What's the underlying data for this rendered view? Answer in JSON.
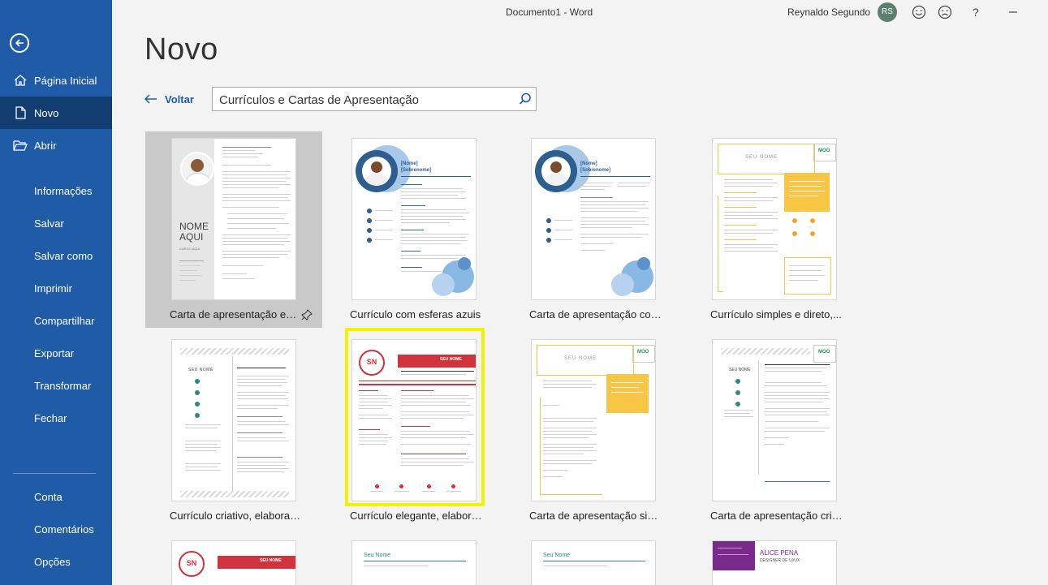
{
  "app": {
    "window_title": "Documento1  -  Word",
    "user_name": "Reynaldo Segundo",
    "user_initials": "RS"
  },
  "sidebar": {
    "items_top": [
      {
        "label": "Página Inicial"
      },
      {
        "label": "Novo"
      },
      {
        "label": "Abrir"
      }
    ],
    "items_mid": [
      {
        "label": "Informações"
      },
      {
        "label": "Salvar"
      },
      {
        "label": "Salvar como"
      },
      {
        "label": "Imprimir"
      },
      {
        "label": "Compartilhar"
      },
      {
        "label": "Exportar"
      },
      {
        "label": "Transformar"
      },
      {
        "label": "Fechar"
      }
    ],
    "items_bottom": [
      {
        "label": "Conta"
      },
      {
        "label": "Comentários"
      },
      {
        "label": "Opções"
      }
    ]
  },
  "main": {
    "title": "Novo",
    "back_label": "Voltar",
    "search_value": "Currículos e Cartas de Apresentação"
  },
  "templates": [
    {
      "label": "Carta de apresentação em t..."
    },
    {
      "label": "Currículo com esferas azuis"
    },
    {
      "label": "Carta de apresentação com..."
    },
    {
      "label": "Currículo simples e direto,..."
    },
    {
      "label": "Currículo criativo, elaborad..."
    },
    {
      "label": "Currículo elegante, elabora..."
    },
    {
      "label": "Carta de apresentação sim..."
    },
    {
      "label": "Carta de apresentação criat..."
    }
  ],
  "thumb_text": {
    "nome_aqui": "NOME AQUI",
    "cargo_aqui": "CARGO AQUI",
    "nome": "[Nome]",
    "sobrenome": "[Sobrenome]",
    "seu_nome_caps": "SEU NOME",
    "seu_nome": "SEU NOME",
    "moo": "MOO",
    "sn": "SN",
    "seu_nome_mixed": "Seu Nome",
    "alice_pena": "ALICE PENA",
    "designer": "DESIGNER DE UI/UX"
  },
  "colors": {
    "sidebar": "#1f5ba6",
    "sidebar_selected": "#123d70",
    "highlight": "#f5f200",
    "red_accent": "#d0333b",
    "blue_accent": "#2c6bad",
    "gold_accent": "#f7c645",
    "purple_accent": "#7a2a8c"
  }
}
